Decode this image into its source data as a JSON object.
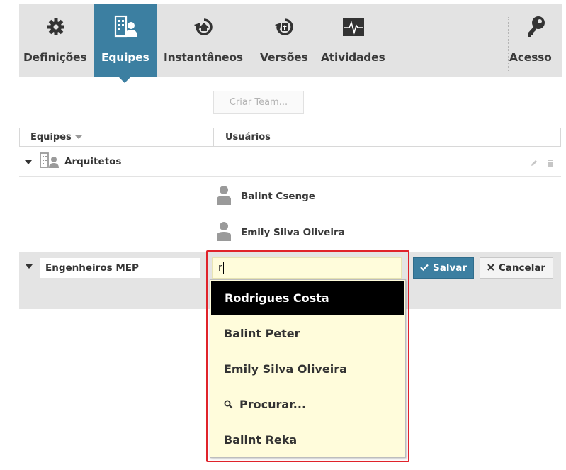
{
  "toolbar": {
    "items": [
      {
        "label": "Definições",
        "icon": "gear-icon"
      },
      {
        "label": "Equipes",
        "icon": "teams-icon"
      },
      {
        "label": "Instantâneos",
        "icon": "snapshot-icon"
      },
      {
        "label": "Versões",
        "icon": "versions-icon"
      },
      {
        "label": "Atividades",
        "icon": "activity-icon"
      },
      {
        "label": "Acesso",
        "icon": "key-icon"
      }
    ],
    "active": "Equipes",
    "accent": "#3c7fa1"
  },
  "create_team_label": "Criar Team...",
  "table": {
    "col_teams": "Equipes",
    "col_users": "Usuários"
  },
  "teams": [
    {
      "name": "Arquitetos",
      "members": [
        "Balint Csenge",
        "Emily Silva Oliveira"
      ]
    }
  ],
  "edit": {
    "team_name": "Engenheiros MEP",
    "user_query": "r",
    "save_label": "Salvar",
    "cancel_label": "Cancelar",
    "suggestions": [
      "Rodrigues Costa",
      "Balint Peter",
      "Emily Silva Oliveira",
      "Procurar...",
      "Balint Reka"
    ],
    "selected_index": 0
  }
}
